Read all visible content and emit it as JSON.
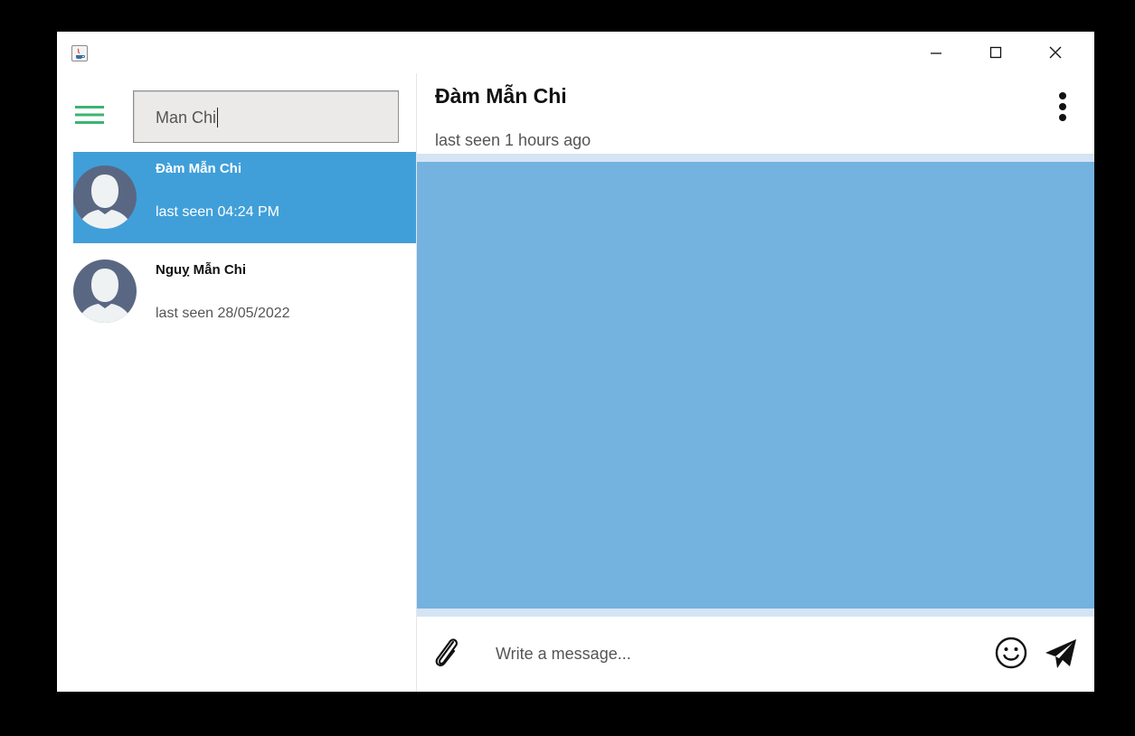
{
  "window": {
    "title": ""
  },
  "search": {
    "value": "Man Chi"
  },
  "contacts": [
    {
      "name": "Đàm Mẫn Chi",
      "status": "last seen 04:24 PM",
      "selected": true
    },
    {
      "name": "Nguỵ Mẫn Chi",
      "status": "last seen 28/05/2022",
      "selected": false
    }
  ],
  "chat": {
    "title": "Đàm Mẫn Chi",
    "subtitle": "last seen 1 hours ago",
    "message_placeholder": "Write a message..."
  },
  "colors": {
    "selected_row": "#409fd9",
    "chat_background": "#74b2df",
    "hamburger": "#3cb371",
    "avatar_dark": "#5a6783",
    "avatar_light": "#eef2f3"
  }
}
